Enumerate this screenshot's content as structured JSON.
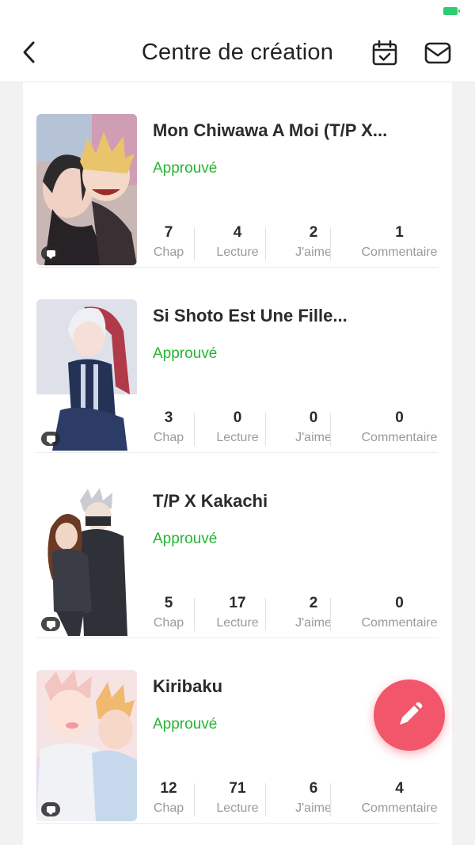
{
  "header": {
    "title": "Centre de création",
    "back_icon": "chevron-left-icon",
    "calendar_icon": "calendar-check-icon",
    "mail_icon": "mail-icon"
  },
  "status_bar": {
    "battery_color": "#2ecc71"
  },
  "accent": {
    "approved": "#26b531",
    "fab": "#f2566a"
  },
  "stories": [
    {
      "title": "Mon Chiwawa A Moi (T/P X...",
      "status": "Approuvé",
      "stats": [
        {
          "value": "7",
          "label": "Chap"
        },
        {
          "value": "4",
          "label": "Lecture"
        },
        {
          "value": "2",
          "label": "J'aime"
        },
        {
          "value": "1",
          "label": "Commentaire"
        }
      ]
    },
    {
      "title": "Si Shoto Est Une Fille...",
      "status": "Approuvé",
      "stats": [
        {
          "value": "3",
          "label": "Chap"
        },
        {
          "value": "0",
          "label": "Lecture"
        },
        {
          "value": "0",
          "label": "J'aime"
        },
        {
          "value": "0",
          "label": "Commentaire"
        }
      ]
    },
    {
      "title": "T/P X Kakachi",
      "status": "Approuvé",
      "stats": [
        {
          "value": "5",
          "label": "Chap"
        },
        {
          "value": "17",
          "label": "Lecture"
        },
        {
          "value": "2",
          "label": "J'aime"
        },
        {
          "value": "0",
          "label": "Commentaire"
        }
      ]
    },
    {
      "title": "Kiribaku",
      "status": "Approuvé",
      "stats": [
        {
          "value": "12",
          "label": "Chap"
        },
        {
          "value": "71",
          "label": "Lecture"
        },
        {
          "value": "6",
          "label": "J'aime"
        },
        {
          "value": "4",
          "label": "Commentaire"
        }
      ]
    }
  ],
  "fab": {
    "icon": "pencil-icon"
  }
}
